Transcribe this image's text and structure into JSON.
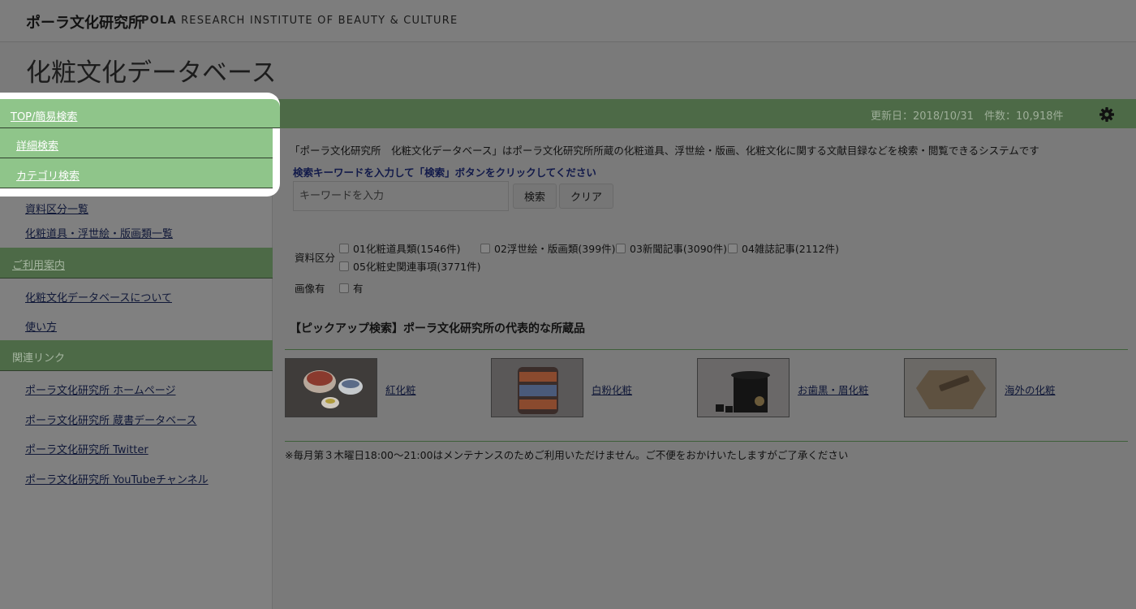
{
  "brand": {
    "name_jp": "ポーラ文化研究所",
    "name_en_bold": "POLA",
    "name_en_rest": "RESEARCH INSTITUTE OF BEAUTY & CULTURE"
  },
  "page_title": "化粧文化データベース",
  "header": {
    "updated": "更新日：2018/10/31",
    "count": "件数：10,918件",
    "settings_icon": "gear-icon"
  },
  "sidebar": {
    "top_menu": "TOP/簡易検索",
    "sub_menu": [
      "詳細検索",
      "カテゴリ検索"
    ],
    "category_links": [
      "資料区分一覧",
      "化粧道具・浮世絵・版画類一覧"
    ],
    "guide_heading": "ご利用案内",
    "guide_links": [
      "化粧文化データベースについて",
      "使い方"
    ],
    "related_heading": "関連リンク",
    "related_links": [
      "ポーラ文化研究所 ホームページ",
      "ポーラ文化研究所 蔵書データベース",
      "ポーラ文化研究所 Twitter",
      "ポーラ文化研究所 YouTubeチャンネル"
    ]
  },
  "main": {
    "intro": "「ポーラ文化研究所　化粧文化データベース」はポーラ文化研究所所蔵の化粧道具、浮世絵・版画、化粧文化に関する文献目録などを検索・閲覧できるシステムです",
    "hint": "検索キーワードを入力して「検索」ボタンをクリックしてください",
    "search_placeholder": "キーワードを入力",
    "search_button": "検索",
    "clear_button": "クリア",
    "filter_label": "資料区分",
    "filters": [
      "01化粧道具類(1546件)",
      "02浮世絵・版画類(399件)",
      "03新聞記事(3090件)",
      "04雑誌記事(2112件)",
      "05化粧史関連事項(3771件)"
    ],
    "image_label": "画像有",
    "image_option": "有",
    "pickup_title": "【ピックアップ検索】ポーラ文化研究所の代表的な所蔵品",
    "pickup_items": [
      "紅化粧",
      "白粉化粧",
      "お歯黒・眉化粧",
      "海外の化粧"
    ],
    "notice": "※毎月第３木曜日18:00～21:00はメンテナンスのためご利用いただけません。ご不便をおかけいたしますがご了承ください"
  }
}
